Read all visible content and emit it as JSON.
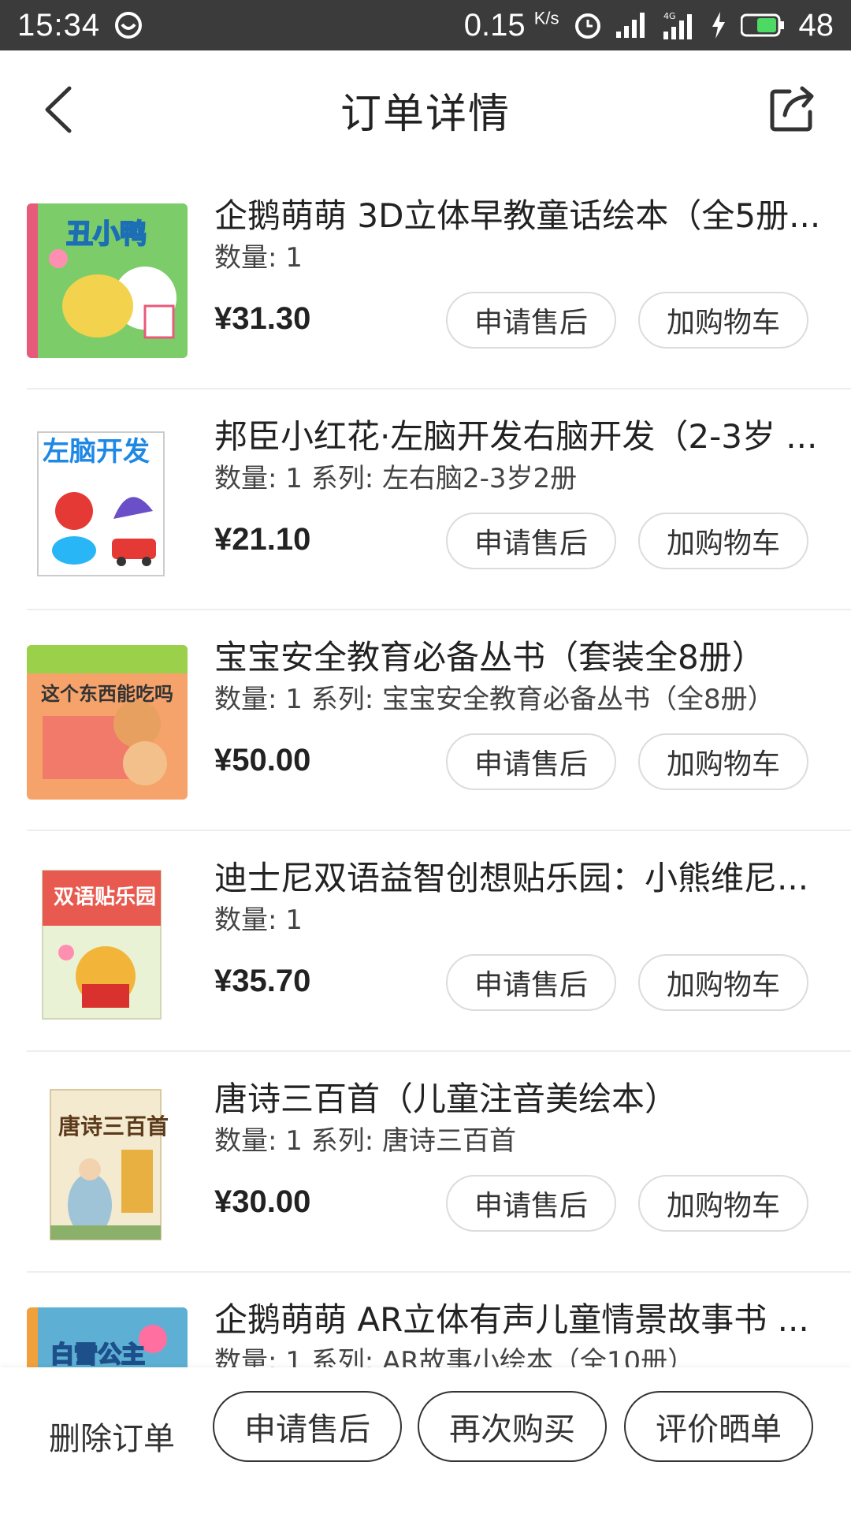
{
  "status_bar": {
    "time": "15:34",
    "net_speed": "0.15",
    "net_unit": "K/s",
    "network": "4G",
    "battery": "48"
  },
  "header": {
    "title": "订单详情"
  },
  "items": [
    {
      "name": "企鹅萌萌 3D立体早教童话绘本（全5册...",
      "qty": "数量: 1",
      "price": "¥31.30",
      "cover_text": "丑小鸭",
      "cover_color": "#6fbf5a"
    },
    {
      "name": "邦臣小红花·左脑开发右脑开发（2-3岁 ...",
      "qty": "数量: 1 系列: 左右脑2-3岁2册",
      "price": "¥21.10",
      "cover_text": "左脑开发",
      "cover_color": "#ffffff"
    },
    {
      "name": "宝宝安全教育必备丛书（套装全8册）",
      "qty": "数量: 1 系列: 宝宝安全教育必备丛书（全8册）",
      "price": "¥50.00",
      "cover_text": "这个东西能吃吗",
      "cover_color": "#f08a4b"
    },
    {
      "name": "迪士尼双语益智创想贴乐园：小熊维尼...",
      "qty": "数量: 1",
      "price": "¥35.70",
      "cover_text": "双语贴乐园",
      "cover_color": "#e9f0d0"
    },
    {
      "name": "唐诗三百首（儿童注音美绘本）",
      "qty": "数量: 1 系列: 唐诗三百首",
      "price": "¥30.00",
      "cover_text": "唐诗三百首",
      "cover_color": "#f4ead0"
    },
    {
      "name": "企鹅萌萌 AR立体有声儿童情景故事书 ...",
      "qty": "数量: 1 系列: AR故事小绘本（全10册）",
      "price": "",
      "cover_text": "白雪公主",
      "cover_color": "#4aa3c9"
    }
  ],
  "item_buttons": {
    "after_sale": "申请售后",
    "add_cart": "加购物车"
  },
  "bottom_bar": {
    "delete": "删除订单",
    "after_sale": "申请售后",
    "rebuy": "再次购买",
    "review": "评价晒单"
  }
}
